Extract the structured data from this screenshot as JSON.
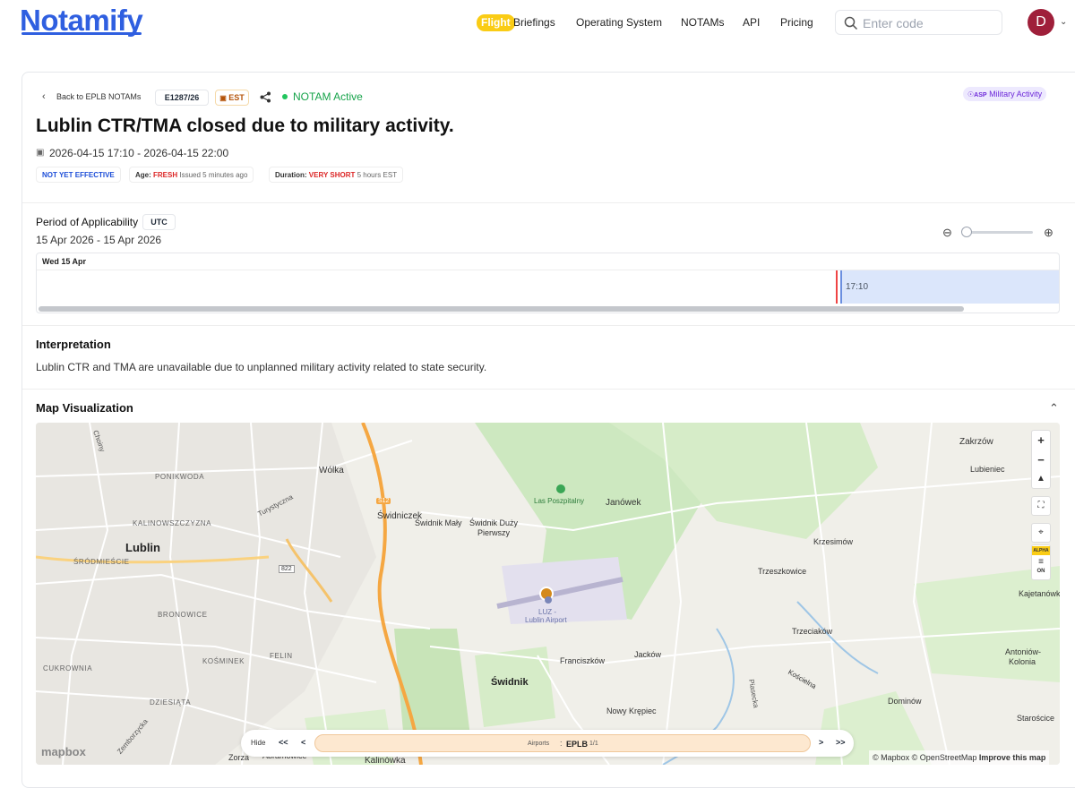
{
  "nav": {
    "logo": "Notamify",
    "flight_badge": "Flight",
    "briefings": "Briefings",
    "operating_system": "Operating System",
    "notams": "NOTAMs",
    "api": "API",
    "pricing": "Pricing",
    "search_placeholder": "Enter code",
    "avatar_initial": "D"
  },
  "notam": {
    "back_label": "Back to EPLB NOTAMs",
    "id": "E1287/26",
    "tz_badge": "EST",
    "status": "NOTAM Active",
    "category_badge": "ASP",
    "category": "Military Activity",
    "title": "Lublin CTR/TMA closed due to military activity.",
    "date_range": "2026-04-15 17:10 - 2026-04-15 22:00",
    "effective_badge": "NOT YET EFFECTIVE",
    "age_label": "Age:",
    "age_value": "FRESH",
    "age_detail": "Issued 5 minutes ago",
    "duration_label": "Duration:",
    "duration_value": "VERY SHORT",
    "duration_detail": "5 hours EST"
  },
  "applicability": {
    "heading": "Period of Applicability",
    "tz": "UTC",
    "range": "15 Apr 2026 - 15 Apr 2026",
    "day_label": "Wed 15 Apr",
    "start_time": "17:10",
    "zoom_level": 0
  },
  "interpretation": {
    "heading": "Interpretation",
    "text": "Lublin CTR and TMA are unavailable due to unplanned military activity related to state security."
  },
  "map": {
    "heading": "Map Visualization",
    "places": {
      "lublin": "Lublin",
      "swidnik": "Świdnik",
      "wolka": "Wólka",
      "swidniczek": "Świdniczek",
      "swidnik_maly": "Świdnik Mały",
      "swidnik_duzy": "Świdnik Duży",
      "pierwszy": "Pierwszy",
      "las": "Las Poszpitalny",
      "janowek": "Janówek",
      "zakrzow": "Zakrzów",
      "lubieniec": "Lubieniec",
      "krzesimow": "Krzesimów",
      "trzeszkowice": "Trzeszkowice",
      "kajetanowka": "Kajetanówka",
      "trzeciakow": "Trzeciaków",
      "antoniow": "Antoniów-",
      "kolonia": "Kolonia",
      "franciszkow": "Franciszków",
      "jackow": "Jacków",
      "koscielna": "Kościelna",
      "dominow": "Dominów",
      "nowy_krepiec": "Nowy Krępiec",
      "staroscice": "Starościce",
      "kalinowka": "Kalinówka",
      "zorza": "Zorza",
      "abramowice": "Abramowice",
      "airport_code": "LUZ -",
      "airport_name": "Lublin Airport",
      "turystyczna": "Turystyczna",
      "zemborzycka": "Zemborzycka",
      "pisecka": "Piasecka",
      "choiny": "Choiny",
      "ponikwoda": "PONIKWODA",
      "kalinowszczyzna": "KALINOWSZCZYZNA",
      "srodmiescie": "ŚRÓDMIEŚCIE",
      "bronowice": "BRONOWICE",
      "kosminek": "KOŚMINEK",
      "felin": "FELIN",
      "cukrownia": "CUKROWNIA",
      "dziesiata": "DZIESIĄTA",
      "road_s12": "S12",
      "road_822": "822"
    },
    "playback": {
      "hide": "Hide",
      "first": "<<",
      "prev": "<",
      "next": ">",
      "last": ">>",
      "airports_label": "Airports",
      "colon": ":",
      "airport": "EPLB",
      "count": "1/1"
    },
    "attribution": {
      "mapbox": "© Mapbox",
      "osm": "© OpenStreetMap",
      "improve": "Improve this map",
      "logo": "mapbox"
    },
    "side_labels": {
      "alpha": "ALPHA",
      "on": "ON"
    }
  }
}
